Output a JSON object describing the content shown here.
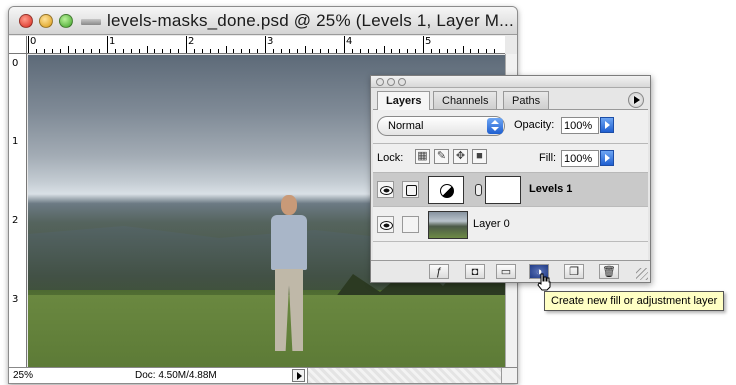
{
  "document": {
    "title": "levels-masks_done.psd @ 25% (Levels 1, Layer M...",
    "zoom": "25%",
    "doc_size": "Doc: 4.50M/4.88M",
    "ruler_h_labels": [
      "0",
      "1",
      "2",
      "3",
      "4",
      "5"
    ],
    "ruler_v_labels": [
      "0",
      "1",
      "2",
      "3"
    ]
  },
  "layers_panel": {
    "tabs": [
      {
        "label": "Layers",
        "active": true
      },
      {
        "label": "Channels",
        "active": false
      },
      {
        "label": "Paths",
        "active": false
      }
    ],
    "blend_mode": "Normal",
    "opacity_label": "Opacity:",
    "opacity_value": "100%",
    "lock_label": "Lock:",
    "fill_label": "Fill:",
    "fill_value": "100%",
    "layers": [
      {
        "name": "Levels 1",
        "selected": true,
        "type": "adjustment"
      },
      {
        "name": "Layer 0",
        "selected": false,
        "type": "image"
      }
    ],
    "footer_buttons": [
      "layer-style",
      "add-mask",
      "new-group",
      "new-fill-adjustment",
      "new-layer",
      "delete-layer"
    ]
  },
  "tooltip": "Create new fill or adjustment layer",
  "colors": {
    "tooltip_bg": "#ffffc4",
    "selected_layer_bg": "#c9c9c9",
    "accent_blue": "#1f5fd0"
  }
}
